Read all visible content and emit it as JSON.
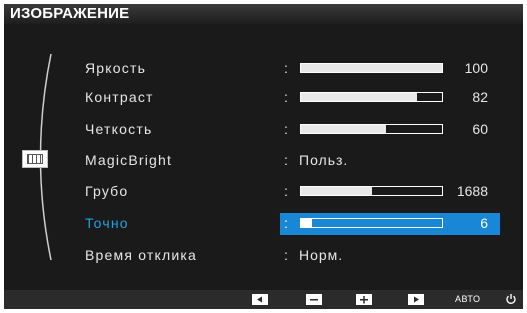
{
  "menu": {
    "title": "ИЗОБРАЖЕНИЕ"
  },
  "settings": [
    {
      "label": "Яркость",
      "value": "100",
      "level": 1.0
    },
    {
      "label": "Контраст",
      "value": "82",
      "level": 0.82
    },
    {
      "label": "Четкость",
      "value": "60",
      "level": 0.6
    },
    {
      "label": "MagicBright",
      "value": "Польз."
    },
    {
      "label": "Грубо",
      "value": "1688",
      "level": 0.5
    },
    {
      "label": "Точно",
      "value": "6",
      "level": 0.06,
      "selected": true
    },
    {
      "label": "Время отклика",
      "value": "Норм."
    }
  ],
  "controls": {
    "auto_label": "АВТО",
    "icons": [
      "left-arrow-icon",
      "minus-icon",
      "plus-icon",
      "right-arrow-icon",
      "power-icon"
    ]
  },
  "colors": {
    "accent": "#1787d6",
    "selected_label": "#1fa2ea",
    "panel_bg": "#1a1a1a"
  }
}
